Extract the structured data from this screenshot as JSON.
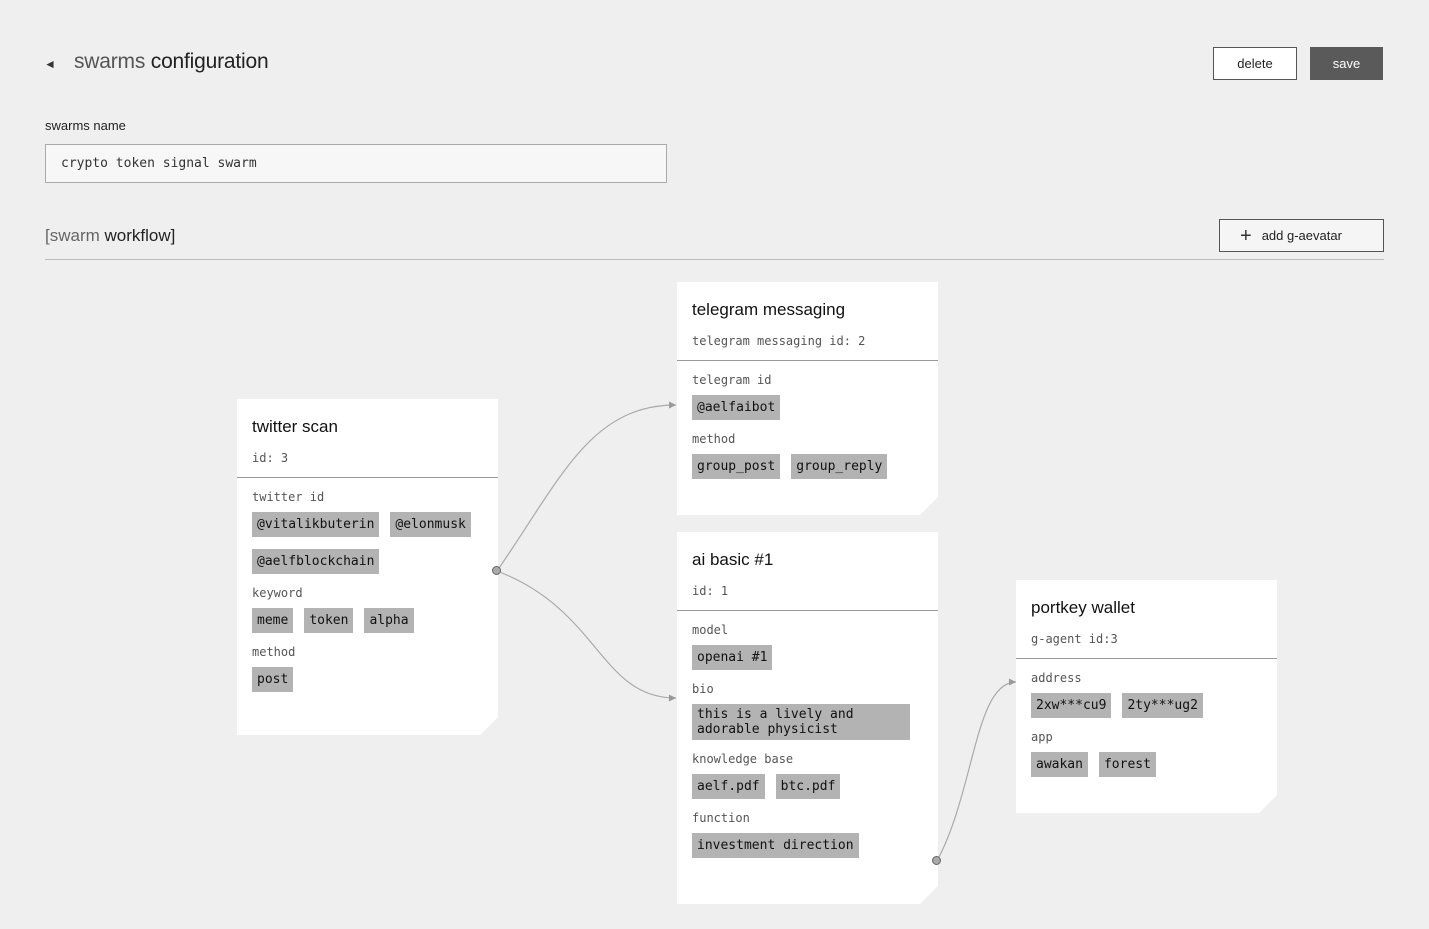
{
  "header": {
    "back_icon": "◄",
    "title_a": "swarms",
    "title_b": "configuration",
    "delete_label": "delete",
    "save_label": "save"
  },
  "form": {
    "name_label": "swarms name",
    "name_value": "crypto token signal swarm"
  },
  "workflow": {
    "title_open": "[swarm",
    "title_close": "workflow]",
    "add_label": "add g-aevatar",
    "add_icon": "plus-icon"
  },
  "cards": {
    "twitter": {
      "title": "twitter scan",
      "subtitle": "id: 3",
      "twitter_id_label": "twitter id",
      "twitter_ids": [
        "@vitalikbuterin",
        "@elonmusk",
        "@aelfblockchain"
      ],
      "keyword_label": "keyword",
      "keywords": [
        "meme",
        "token",
        "alpha"
      ],
      "method_label": "method",
      "methods": [
        "post"
      ]
    },
    "telegram": {
      "title": "telegram messaging",
      "subtitle": "telegram messaging id: 2",
      "telegram_id_label": "telegram id",
      "telegram_ids": [
        "@aelfaibot"
      ],
      "method_label": "method",
      "methods": [
        "group_post",
        "group_reply"
      ]
    },
    "ai": {
      "title": "ai basic #1",
      "subtitle": "id: 1",
      "model_label": "model",
      "models": [
        "openai #1"
      ],
      "bio_label": "bio",
      "bio": "this is a lively and adorable physicist",
      "kb_label": "knowledge base",
      "kb": [
        "aelf.pdf",
        "btc.pdf"
      ],
      "function_label": "function",
      "functions": [
        "investment direction"
      ]
    },
    "wallet": {
      "title": "portkey wallet",
      "subtitle": "g-agent id:3",
      "address_label": "address",
      "addresses": [
        "2xw***cu9",
        "2ty***ug2"
      ],
      "app_label": "app",
      "apps": [
        "awakan",
        "forest"
      ]
    }
  },
  "colors": {
    "background": "#efefef",
    "chip": "#b3b3b3",
    "save_button": "#5a5a5a",
    "connector": "#aaaaaa"
  }
}
